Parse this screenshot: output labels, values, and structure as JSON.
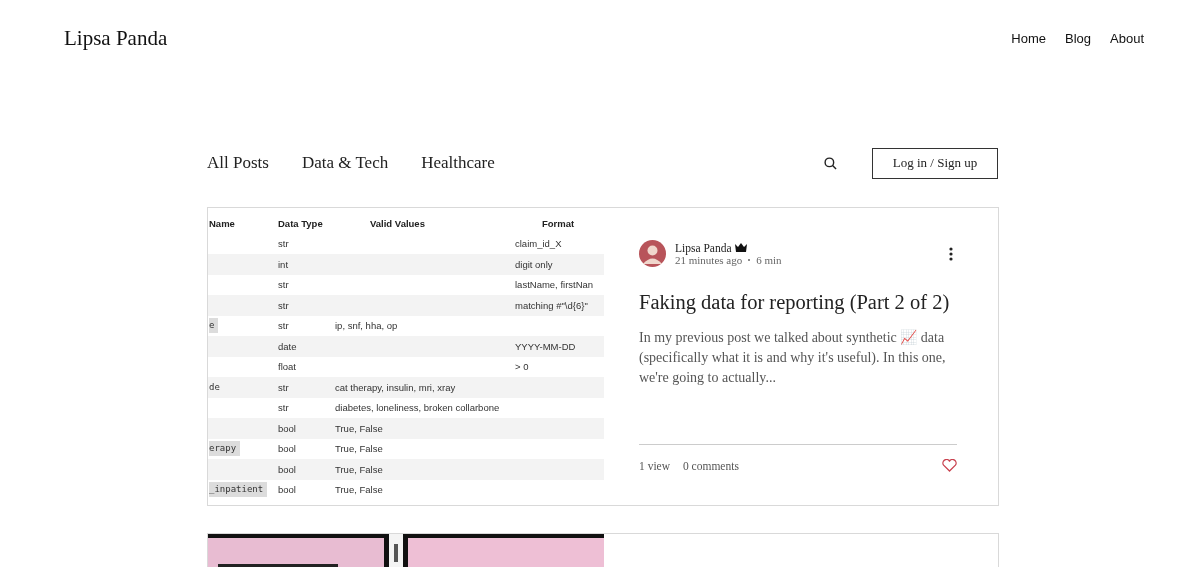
{
  "header": {
    "site_title": "Lipsa Panda",
    "nav": [
      {
        "label": "Home"
      },
      {
        "label": "Blog"
      },
      {
        "label": "About"
      }
    ]
  },
  "categories": [
    {
      "label": "All Posts"
    },
    {
      "label": "Data & Tech"
    },
    {
      "label": "Healthcare"
    }
  ],
  "login_button": "Log in / Sign up",
  "posts": [
    {
      "image": {
        "kind": "table",
        "columns": [
          "Name",
          "Data Type",
          "Valid Values",
          "Format"
        ],
        "rows": [
          {
            "cells": [
              "",
              "str",
              "",
              "claim_id_X"
            ],
            "highlighted": false
          },
          {
            "cells": [
              "",
              "int",
              "",
              "digit only"
            ],
            "highlighted": false
          },
          {
            "cells": [
              "",
              "str",
              "",
              "lastName, firstNan"
            ],
            "highlighted": false
          },
          {
            "cells": [
              "",
              "str",
              "",
              "matching #\"\\d{6}\""
            ],
            "highlighted": false
          },
          {
            "cells": [
              "e",
              "str",
              "ip, snf, hha, op",
              ""
            ],
            "highlighted": true
          },
          {
            "cells": [
              "",
              "date",
              "",
              "YYYY-MM-DD"
            ],
            "highlighted": false
          },
          {
            "cells": [
              "",
              "float",
              "",
              "> 0"
            ],
            "highlighted": false
          },
          {
            "cells": [
              "de",
              "str",
              "cat therapy, insulin, mri, xray",
              ""
            ],
            "highlighted": false
          },
          {
            "cells": [
              "",
              "str",
              "diabetes, loneliness, broken collarbone",
              ""
            ],
            "highlighted": false
          },
          {
            "cells": [
              "",
              "bool",
              "True, False",
              ""
            ],
            "highlighted": false
          },
          {
            "cells": [
              "erapy",
              "bool",
              "True, False",
              ""
            ],
            "highlighted": true
          },
          {
            "cells": [
              "",
              "bool",
              "True, False",
              ""
            ],
            "highlighted": false
          },
          {
            "cells": [
              "_inpatient",
              "bool",
              "True, False",
              ""
            ],
            "highlighted": true
          }
        ]
      },
      "author": "Lipsa Panda",
      "time": "21 minutes ago",
      "read_time": "6 min",
      "title": "Faking data for reporting (Part 2 of 2)",
      "excerpt": "In my previous post we talked about synthetic 📈  data (specifically what it is and why it's useful). In this one, we're going to actually...",
      "views": "1 view",
      "comments": "0 comments",
      "liked": false
    },
    {
      "image": {
        "kind": "picture"
      }
    }
  ]
}
